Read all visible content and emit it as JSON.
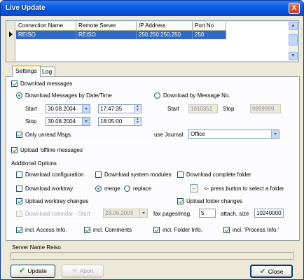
{
  "window": {
    "title": "Live Update",
    "close": "X"
  },
  "grid": {
    "columns": [
      "Connection Name",
      "Remote Server",
      "IP Address",
      "Port No"
    ],
    "rows": [
      {
        "connection": "REISO",
        "server": "REISO",
        "ip": "250.250.250.250",
        "port": "250"
      }
    ],
    "scroll_up": "▲",
    "scroll_down": "▼"
  },
  "tabs": [
    "Settings",
    "Log"
  ],
  "settings": {
    "download_messages": "Download messages",
    "by_date": "Download Messages by Date/Time",
    "by_number": "Download by Message No.",
    "start_label": "Start",
    "stop_label": "Stop",
    "start_date": "30.08.2004",
    "start_time": "17:47:35",
    "stop_date": "30.08.2004",
    "stop_time": "18:05:00",
    "msg_start_label": "Start",
    "msg_stop_label": "Stop",
    "msg_start": "1010351",
    "msg_stop": "9999999",
    "only_unread": "Only unread Msgs.",
    "use_journal_label": "use Journal",
    "journal_value": "Office",
    "upload_offline": "Upload 'offline messages'",
    "additional_options": "Additional Options",
    "download_configuration": "Download configuration",
    "download_system_modules": "Download system modules",
    "download_complete_folder": "Download complete folder",
    "download_worktray": "Download worktray",
    "merge": "merge",
    "replace": "replace",
    "browse_button": "...",
    "press_button_hint": "<- press button to select a folder",
    "upload_worktray_changes": "Upload worktray changes",
    "upload_folder_changes": "Upload folder changes",
    "download_calendar": "Download calendar - Start",
    "calendar_start": "23.06.2003",
    "fax_pages_label": "fax pages/msg.",
    "fax_pages": "5",
    "attach_size_label": "attach. size",
    "attach_size": "10240000",
    "incl_access": "incl. Access Info.",
    "incl_comments": "incl. Comments",
    "incl_folder": "incl. Folder Info.",
    "incl_process": "incl. 'Process Info.'"
  },
  "status": {
    "server_name": "Server Name Reiso"
  },
  "buttons": {
    "update": "Update",
    "abort": "Abort",
    "close": "Close"
  }
}
